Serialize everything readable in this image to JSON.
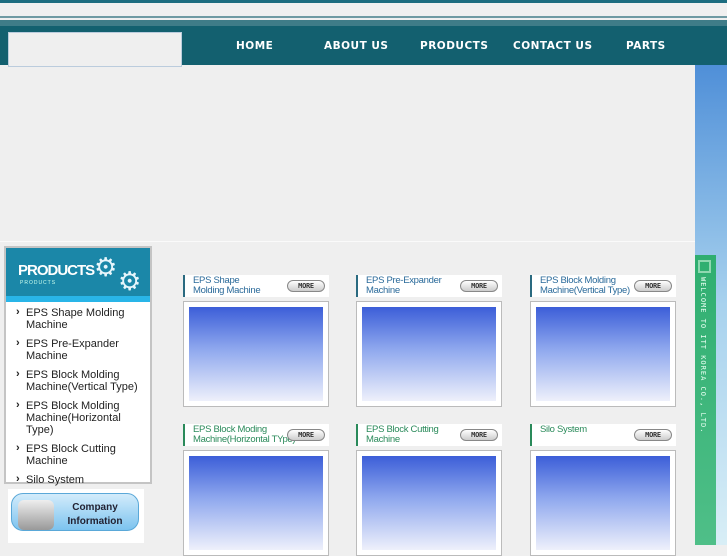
{
  "nav": {
    "items": [
      "HOME",
      "ABOUT US",
      "PRODUCTS",
      "CONTACT US",
      "PARTS"
    ]
  },
  "side": {
    "title": "PRODUCTS",
    "subtitle": "PRODUCTS",
    "items": [
      "EPS Shape Molding Machine",
      "EPS Pre-Expander Machine",
      "EPS Block Molding Machine(Vertical Type)",
      "EPS Block Molding Machine(Horizontal Type)",
      "EPS Block Cutting Machine",
      "Silo System"
    ],
    "company": "Company Information"
  },
  "banner": {
    "welcome": "WELCOME TO ITT KOREA CO., LTD."
  },
  "more_label": "MORE",
  "products": [
    {
      "l1": "EPS Shape",
      "l2": "Molding Machine"
    },
    {
      "l1": "EPS Pre-Expander",
      "l2": "Machine"
    },
    {
      "l1": "EPS Block Molding",
      "l2": "Machine(Vertical Type)"
    },
    {
      "l1": "EPS Block Moding",
      "l2": "Machine(Horizontal TYpe)"
    },
    {
      "l1": "EPS Block Cutting",
      "l2": "Machine"
    },
    {
      "l1": "Silo System",
      "l2": ""
    }
  ]
}
